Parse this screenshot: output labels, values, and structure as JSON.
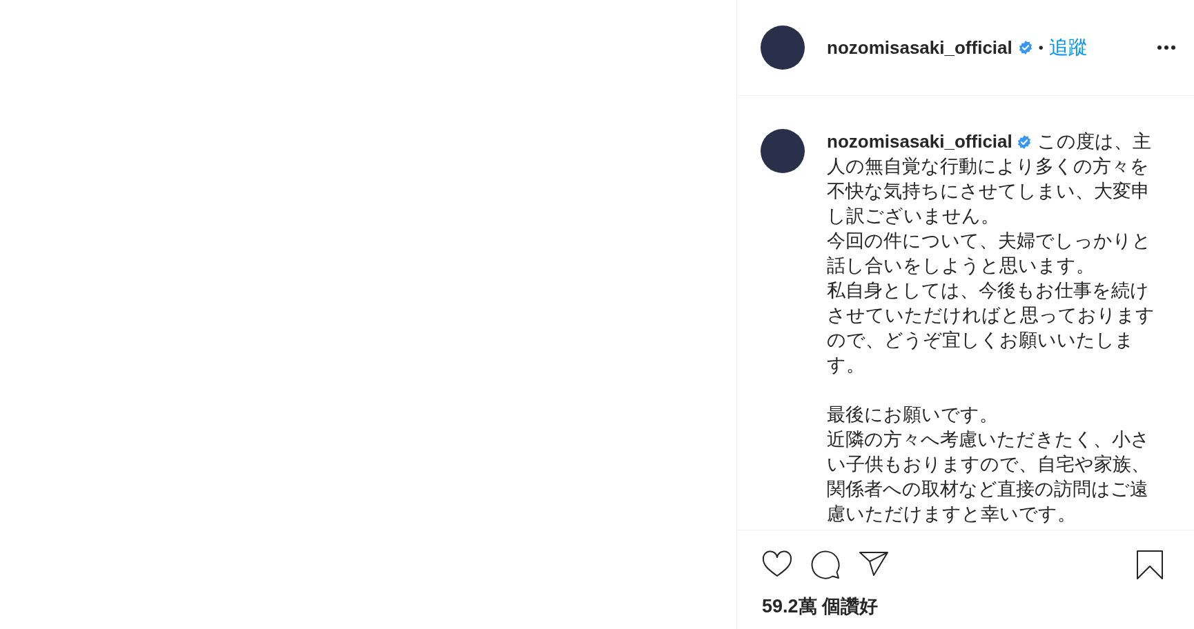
{
  "header": {
    "username": "nozomisasaki_official",
    "verified": true,
    "separator": "•",
    "follow": "追蹤"
  },
  "caption": {
    "username": "nozomisasaki_official",
    "verified": true,
    "sections": [
      [
        "この度は、主人の無自覚な行動により多くの方々を不快な気持ちにさせてしまい、大変申し訳ございません。",
        "今回の件について、夫婦でしっかりと話し合いをしようと思います。",
        "私自身としては、今後もお仕事を続けさせていただければと思っておりますので、どうぞ宜しくお願いいたします。"
      ],
      [
        "最後にお願いです。",
        "近隣の方々へ考慮いただきたく、小さい子供もおりますので、自宅や家族、関係者への取材など直接の訪問はご遠慮いただけますと幸いです。"
      ]
    ]
  },
  "likes": "59.2萬 個讚好"
}
